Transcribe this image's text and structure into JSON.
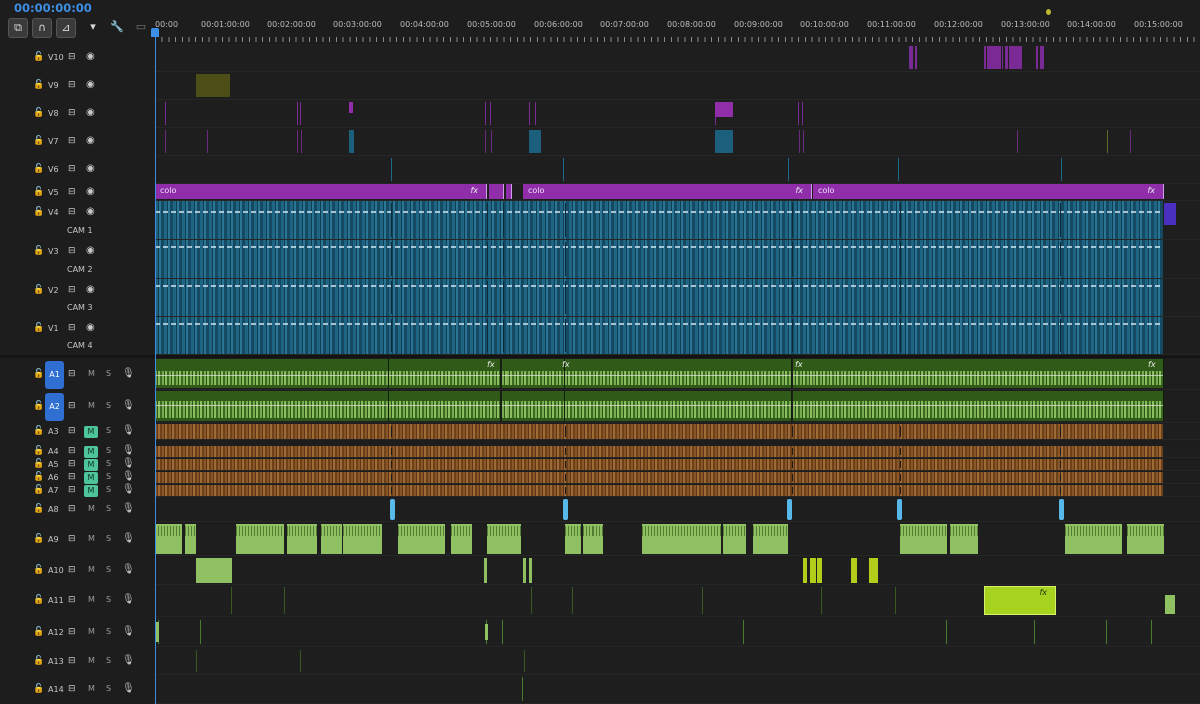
{
  "timecode": "00:00:00:00",
  "ruler_labels": [
    "00:00",
    "00:01:00:00",
    "00:02:00:00",
    "00:03:00:00",
    "00:04:00:00",
    "00:05:00:00",
    "00:06:00:00",
    "00:07:00:00",
    "00:08:00:00",
    "00:09:00:00",
    "00:10:00:00",
    "00:11:00:00",
    "00:12:00:00",
    "00:13:00:00",
    "00:14:00:00",
    "00:15:00:00"
  ],
  "video_tracks": [
    {
      "name": "V10",
      "sub": ""
    },
    {
      "name": "V9",
      "sub": ""
    },
    {
      "name": "V8",
      "sub": ""
    },
    {
      "name": "V7",
      "sub": ""
    },
    {
      "name": "V6",
      "sub": ""
    },
    {
      "name": "V5",
      "sub": ""
    },
    {
      "name": "V4",
      "sub": "CAM 1"
    },
    {
      "name": "V3",
      "sub": "CAM 2"
    },
    {
      "name": "V2",
      "sub": "CAM 3"
    },
    {
      "name": "V1",
      "sub": "CAM 4"
    }
  ],
  "audio_tracks": [
    {
      "name": "A1",
      "targeted": true,
      "mute": "M",
      "solo": "S",
      "monitor": false
    },
    {
      "name": "A2",
      "targeted": true,
      "mute": "M",
      "solo": "S",
      "monitor": false
    },
    {
      "name": "A3",
      "targeted": false,
      "mute": "M",
      "solo": "S",
      "monitor": true
    },
    {
      "name": "A4",
      "targeted": false,
      "mute": "M",
      "solo": "S",
      "monitor": true
    },
    {
      "name": "A5",
      "targeted": false,
      "mute": "M",
      "solo": "S",
      "monitor": true
    },
    {
      "name": "A6",
      "targeted": false,
      "mute": "M",
      "solo": "S",
      "monitor": true
    },
    {
      "name": "A7",
      "targeted": false,
      "mute": "M",
      "solo": "S",
      "monitor": true
    },
    {
      "name": "A8",
      "targeted": false,
      "mute": "M",
      "solo": "S",
      "monitor": false
    },
    {
      "name": "A9",
      "targeted": false,
      "mute": "M",
      "solo": "S",
      "monitor": false
    },
    {
      "name": "A10",
      "targeted": false,
      "mute": "M",
      "solo": "S",
      "monitor": false
    },
    {
      "name": "A11",
      "targeted": false,
      "mute": "M",
      "solo": "S",
      "monitor": false
    },
    {
      "name": "A12",
      "targeted": false,
      "mute": "M",
      "solo": "S",
      "monitor": false
    },
    {
      "name": "A13",
      "targeted": false,
      "mute": "M",
      "solo": "S",
      "monitor": false
    },
    {
      "name": "A14",
      "targeted": false,
      "mute": "M",
      "solo": "S",
      "monitor": false
    }
  ],
  "v5_clips": [
    {
      "label": "colo",
      "fx": "fx"
    },
    {
      "label": "colo",
      "fx": "fx"
    },
    {
      "label": "colo",
      "fx": "fx"
    }
  ],
  "a11_clip_fx": "fx",
  "a1_fx": [
    "fx",
    "fx",
    "fx",
    "fx"
  ],
  "colors": {
    "accent_blue": "#3d8ee6",
    "purple": "#8f2ea8",
    "cam_blue": "#1c5f7d",
    "audio_green": "#2f5a18",
    "audio_light": "#8fc062",
    "audio_brown": "#7a4b22",
    "monitor_green": "#4ec49a"
  },
  "icons": {
    "tools": [
      "nest-icon",
      "snap-magnet-icon",
      "linked-selection-icon",
      "add-marker-icon",
      "wrench-icon",
      "captions-icon"
    ],
    "track": [
      "lock-icon",
      "sync-lock-icon",
      "eye-icon",
      "mic-icon"
    ]
  }
}
